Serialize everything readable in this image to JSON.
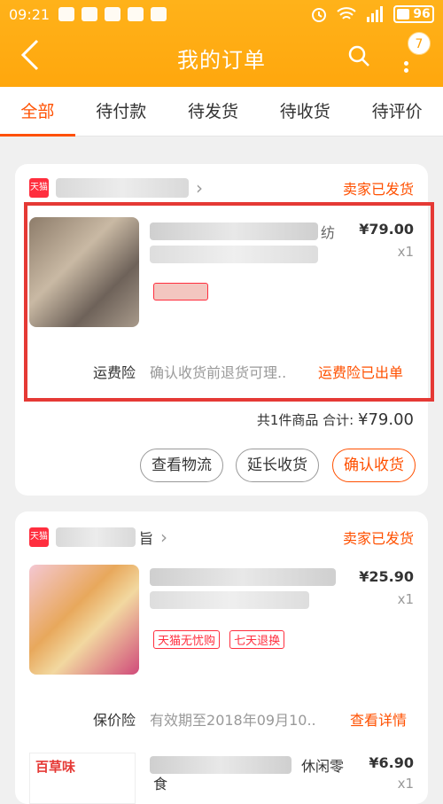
{
  "statusbar": {
    "time": "09:21",
    "battery": "96"
  },
  "nav": {
    "title": "我的订单",
    "badge": "7"
  },
  "tabs": [
    "全部",
    "待付款",
    "待发货",
    "待收货",
    "待评价"
  ],
  "order1": {
    "store_badge": "天猫",
    "status": "卖家已发货",
    "product_title_fragment": "纺",
    "price": "¥79.00",
    "qty": "x1",
    "insurance_label": "运费险",
    "insurance_text": "确认收货前退货可理..",
    "insurance_action": "运费险已出单",
    "summary_prefix": "共1件商品  合计:",
    "summary_total": "¥79.00",
    "buttons": [
      "查看物流",
      "延长收货",
      "确认收货"
    ]
  },
  "order2": {
    "store_badge": "天猫",
    "store_name_fragment": "旨",
    "status": "卖家已发货",
    "price": "¥25.90",
    "qty": "x1",
    "tags": [
      "天猫无忧购",
      "七天退换"
    ],
    "insurance_label": "保价险",
    "insurance_text": "有效期至2018年09月10..",
    "insurance_action": "查看详情"
  },
  "order3": {
    "brand": "百草味",
    "title_fragment": "休闲零",
    "title_fragment2": "食",
    "price": "¥6.90",
    "qty": "x1"
  }
}
